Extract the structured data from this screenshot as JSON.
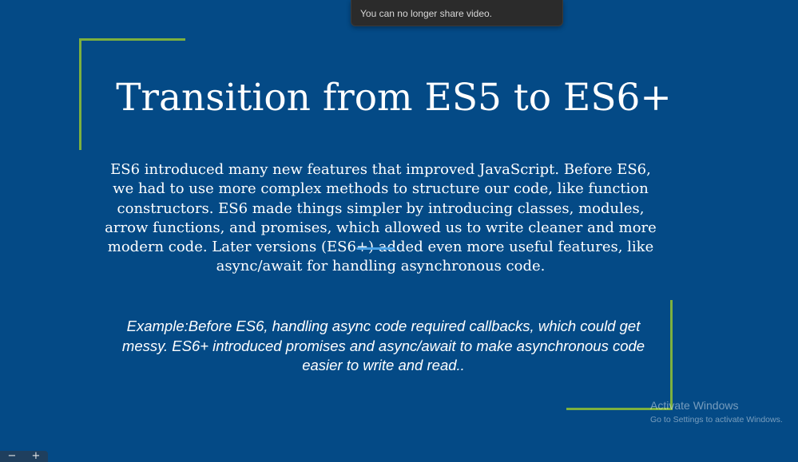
{
  "notification": {
    "text": "You can no longer share video."
  },
  "slide": {
    "title": "Transition from ES5 to ES6+",
    "body": "ES6 introduced many new features that improved JavaScript. Before ES6, we had to use more complex methods to structure our code, like function constructors. ES6 made things simpler by introducing classes, modules, arrow functions, and promises, which allowed us to write cleaner and more modern code. Later versions (ES6+) added even more useful features, like async/await for handling asynchronous code.",
    "example": "Example:Before ES6, handling async code required callbacks, which could get messy. ES6+ introduced promises and async/await to make asynchronous code easier to write and read.."
  },
  "watermark": {
    "title": "Activate Windows",
    "subtitle": "Go to Settings to activate Windows."
  },
  "zoom": {
    "minus_label": "−",
    "plus_label": "+"
  },
  "colors": {
    "background": "#044a86",
    "accent_bracket": "#7db03f",
    "text": "#ffffff"
  }
}
